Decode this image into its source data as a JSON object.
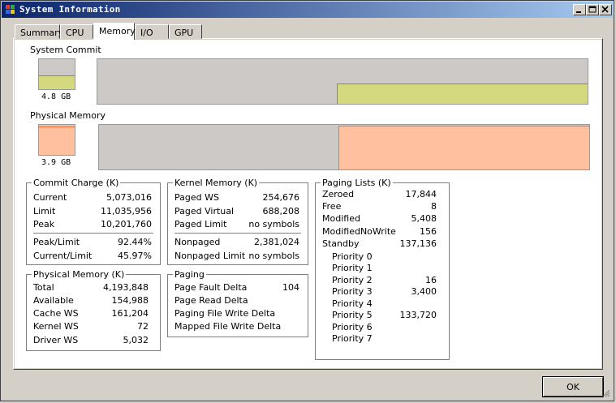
{
  "window": {
    "title": "System Information"
  },
  "tabs": [
    "Summary",
    "CPU",
    "Memory",
    "I/O",
    "GPU"
  ],
  "active_tab": "Memory",
  "system_commit": {
    "label": "System Commit",
    "value": "4.8 GB",
    "fill_fraction": 0.44,
    "color": "#d4d980",
    "line_color": "#8a9a00"
  },
  "physical_memory_graph": {
    "label": "Physical Memory",
    "value": "3.9 GB",
    "fill_fraction": 0.93,
    "color": "#ffc0a0",
    "line_color": "#ff6a30"
  },
  "commit_charge": {
    "title": "Commit Charge (K)",
    "rows": [
      {
        "label": "Current",
        "value": "5,073,016"
      },
      {
        "label": "Limit",
        "value": "11,035,956"
      },
      {
        "label": "Peak",
        "value": "10,201,760"
      },
      {
        "label": "Peak/Limit",
        "value": "92.44%"
      },
      {
        "label": "Current/Limit",
        "value": "45.97%"
      }
    ]
  },
  "kernel_memory": {
    "title": "Kernel Memory (K)",
    "rows": [
      {
        "label": "Paged WS",
        "value": "254,676"
      },
      {
        "label": "Paged Virtual",
        "value": "688,208"
      },
      {
        "label": "Paged Limit",
        "value": "no symbols"
      },
      {
        "label": "Nonpaged",
        "value": "2,381,024"
      },
      {
        "label": "Nonpaged Limit",
        "value": "no symbols"
      }
    ]
  },
  "paging_lists": {
    "title": "Paging Lists (K)",
    "rows": [
      {
        "label": "Zeroed",
        "value": "17,844"
      },
      {
        "label": "Free",
        "value": "8"
      },
      {
        "label": "Modified",
        "value": "5,408"
      },
      {
        "label": "ModifiedNoWrite",
        "value": "156"
      },
      {
        "label": "Standby",
        "value": "137,136"
      }
    ],
    "priorities": [
      {
        "label": "Priority 0",
        "value": ""
      },
      {
        "label": "Priority 1",
        "value": ""
      },
      {
        "label": "Priority 2",
        "value": "16"
      },
      {
        "label": "Priority 3",
        "value": "3,400"
      },
      {
        "label": "Priority 4",
        "value": ""
      },
      {
        "label": "Priority 5",
        "value": "133,720"
      },
      {
        "label": "Priority 6",
        "value": ""
      },
      {
        "label": "Priority 7",
        "value": ""
      }
    ]
  },
  "physical_memory": {
    "title": "Physical Memory (K)",
    "rows": [
      {
        "label": "Total",
        "value": "4,193,848"
      },
      {
        "label": "Available",
        "value": "154,988"
      },
      {
        "label": "Cache WS",
        "value": "161,204"
      },
      {
        "label": "Kernel WS",
        "value": "72"
      },
      {
        "label": "Driver WS",
        "value": "5,032"
      }
    ]
  },
  "paging": {
    "title": "Paging",
    "rows": [
      {
        "label": "Page Fault Delta",
        "value": "104"
      },
      {
        "label": "Page Read Delta",
        "value": ""
      },
      {
        "label": "Paging File Write Delta",
        "value": ""
      },
      {
        "label": "Mapped File Write Delta",
        "value": ""
      }
    ]
  },
  "buttons": {
    "ok": "OK"
  }
}
